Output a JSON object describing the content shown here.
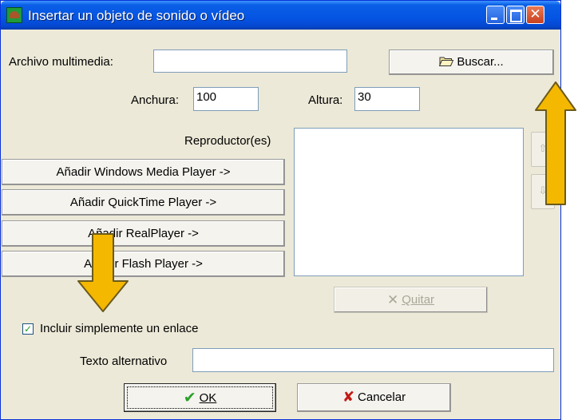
{
  "window": {
    "title": "Insertar un objeto de sonido o vídeo"
  },
  "fields": {
    "archivo_label": "Archivo multimedia:",
    "archivo_value": "",
    "anchura_label": "Anchura:",
    "anchura_value": "100",
    "altura_label": "Altura:",
    "altura_value": "30",
    "texto_alt_label": "Texto alternativo",
    "texto_alt_value": ""
  },
  "buttons": {
    "buscar": "Buscar...",
    "add_wmp": "Añadir Windows Media Player ->",
    "add_qt": "Añadir QuickTime Player ->",
    "add_real": "Añadir RealPlayer ->",
    "add_flash": "Añadir Flash Player ->",
    "quitar": "Quitar",
    "ok": "OK",
    "cancelar": "Cancelar"
  },
  "players_label": "Reproductor(es)",
  "players_list": [],
  "checkbox": {
    "label": "Incluir simplemente un enlace",
    "checked": true
  },
  "colors": {
    "title_bar": "#0554e3",
    "dialog_bg": "#ece9d8",
    "annotation_arrow": "#f5b800"
  }
}
